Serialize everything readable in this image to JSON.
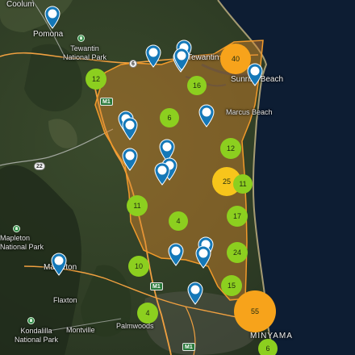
{
  "places": [
    {
      "id": "coolum",
      "text": "Coolum"
    },
    {
      "id": "pomona",
      "text": "Pomona"
    },
    {
      "id": "tewantin-np",
      "text": "Tewantin\nNational Park"
    },
    {
      "id": "tewantin",
      "text": "Tewantin"
    },
    {
      "id": "sunrise-beach",
      "text": "Sunrise Beach"
    },
    {
      "id": "marcus-beach",
      "text": "Marcus Beach"
    },
    {
      "id": "mapleton-np",
      "text": "Mapleton\nNational Park"
    },
    {
      "id": "mapleton",
      "text": "Mapleton"
    },
    {
      "id": "flaxton",
      "text": "Flaxton"
    },
    {
      "id": "palmwoods",
      "text": "Palmwoods"
    },
    {
      "id": "montville",
      "text": "Montville"
    },
    {
      "id": "kondalilla-np",
      "text": "Kondalilla\nNational Park"
    },
    {
      "id": "minyama",
      "text": "MINYAMA"
    }
  ],
  "road_shields": [
    {
      "id": "r6",
      "text": "6"
    },
    {
      "id": "m1a",
      "text": "M1"
    },
    {
      "id": "r22",
      "text": "22"
    },
    {
      "id": "m1b",
      "text": "M1"
    },
    {
      "id": "m1c",
      "text": "M1"
    }
  ],
  "clusters": [
    {
      "id": "c40",
      "count": 40,
      "level": "high"
    },
    {
      "id": "c12a",
      "count": 12,
      "level": "low"
    },
    {
      "id": "c16",
      "count": 16,
      "level": "low"
    },
    {
      "id": "c6a",
      "count": 6,
      "level": "low"
    },
    {
      "id": "c12b",
      "count": 12,
      "level": "low"
    },
    {
      "id": "c25",
      "count": 25,
      "level": "mid"
    },
    {
      "id": "c11a",
      "count": 11,
      "level": "low"
    },
    {
      "id": "c11b",
      "count": 11,
      "level": "low"
    },
    {
      "id": "c4a",
      "count": 4,
      "level": "low"
    },
    {
      "id": "c17",
      "count": 17,
      "level": "low"
    },
    {
      "id": "c24",
      "count": 24,
      "level": "low"
    },
    {
      "id": "c10",
      "count": 10,
      "level": "low"
    },
    {
      "id": "c15",
      "count": 15,
      "level": "low"
    },
    {
      "id": "c55",
      "count": 55,
      "level": "high"
    },
    {
      "id": "c4b",
      "count": 4,
      "level": "low"
    },
    {
      "id": "c6b",
      "count": 6,
      "level": "low"
    }
  ],
  "colors": {
    "cluster_low": "#8ccf1f",
    "cluster_mid": "#f7c51b",
    "cluster_high": "#f7a31b",
    "boundary_fill": "#d8862a",
    "boundary_stroke": "#f29a2a",
    "pin": "#1478b8",
    "ocean": "#0d1d33"
  },
  "pins": {
    "count": 18,
    "icon": "map-marker-icon"
  }
}
